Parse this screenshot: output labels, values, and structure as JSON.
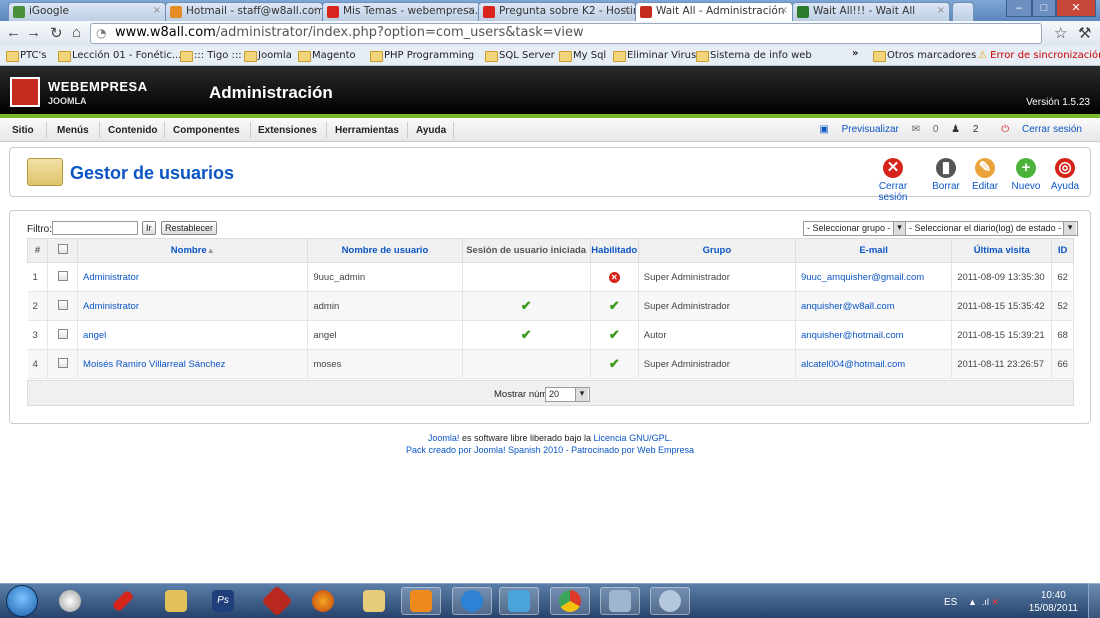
{
  "browser": {
    "tabs": [
      {
        "label": "iGoogle",
        "favicon_color": "#4a8f3a"
      },
      {
        "label": "Hotmail - staff@w8all.com",
        "favicon_color": "#e58b23"
      },
      {
        "label": "Mis Temas - webempresa.jo",
        "favicon_color": "#d8241c"
      },
      {
        "label": "Pregunta sobre K2 - Hosting",
        "favicon_color": "#d8241c"
      },
      {
        "label": "Wait All - Administración",
        "favicon_color": "#c62b1f"
      },
      {
        "label": "Wait All!!! - Wait All",
        "favicon_color": "#2a7a2a"
      }
    ],
    "url_host": "www.w8all.com",
    "url_path": "/administrator/index.php?option=com_users&task=view",
    "bookmarks": [
      "PTC's",
      "Lección 01 - Fonétic...",
      "::: Tigo :::",
      "Joomla",
      "Magento",
      "PHP Programming",
      "SQL Server",
      "My Sql",
      "Eliminar Virus",
      "Sistema de info web"
    ],
    "bookmarks_overflow": "»",
    "other_bookmarks": "Otros marcadores",
    "sync_error": "Error de sincronización"
  },
  "header": {
    "brand": "WEBEMPRESA",
    "brand_sub": "JOOMLA",
    "title": "Administración",
    "version": "Versión 1.5.23"
  },
  "menu": [
    "Sitio",
    "Menús",
    "Contenido",
    "Componentes",
    "Extensiones",
    "Herramientas",
    "Ayuda"
  ],
  "status": {
    "preview": "Previsualizar",
    "messages": "0",
    "users_online": "2",
    "logout": "Cerrar sesión"
  },
  "page": {
    "title": "Gestor de usuarios",
    "toolbar": [
      {
        "label": "Cerrar sesión",
        "color": "#d6241a",
        "glyph": "✕",
        "icon": "logout-icon"
      },
      {
        "label": "Borrar",
        "color": "#555555",
        "glyph": "▮",
        "icon": "trash-icon"
      },
      {
        "label": "Editar",
        "color": "#e8a33a",
        "glyph": "✎",
        "icon": "pencil-icon"
      },
      {
        "label": "Nuevo",
        "color": "#4bb33a",
        "glyph": "+",
        "icon": "plus-icon"
      },
      {
        "label": "Ayuda",
        "color": "#d6241a",
        "glyph": "◎",
        "icon": "help-icon"
      }
    ]
  },
  "filter": {
    "label": "Filtro:",
    "value": "",
    "go": "Ir",
    "reset": "Restablecer",
    "group_select": "- Seleccionar grupo -",
    "log_select": "- Seleccionar el diario(log) de estado -"
  },
  "table": {
    "headers": [
      "#",
      "",
      "Nombre",
      "Nombre de usuario",
      "Sesión de usuario iniciada",
      "Habilitado",
      "Grupo",
      "E-mail",
      "Última visita",
      "ID"
    ],
    "sort_arrow": "▲",
    "rows": [
      {
        "num": "1",
        "name": "Administrator",
        "username": "9uuc_admin",
        "logged_in": false,
        "enabled": false,
        "group": "Super Administrador",
        "email": "9uuc_amquisher@gmail.com",
        "last_visit": "2011-08-09 13:35:30",
        "id": "62"
      },
      {
        "num": "2",
        "name": "Administrator",
        "username": "admin",
        "logged_in": true,
        "enabled": true,
        "group": "Super Administrador",
        "email": "anquisher@w8all.com",
        "last_visit": "2011-08-15 15:35:42",
        "id": "52"
      },
      {
        "num": "3",
        "name": "angel",
        "username": "angel",
        "logged_in": true,
        "enabled": true,
        "group": "Autor",
        "email": "anquisher@hotmail.com",
        "last_visit": "2011-08-15 15:39:21",
        "id": "68"
      },
      {
        "num": "4",
        "name": "Moisés Ramiro Villarreal Sánchez",
        "username": "moses",
        "logged_in": false,
        "enabled": true,
        "group": "Super Administrador",
        "email": "alcatel004@hotmail.com",
        "last_visit": "2011-08-11 23:26:57",
        "id": "66"
      }
    ],
    "limit_label": "Mostrar núm.",
    "limit_value": "20"
  },
  "footer": {
    "joomla": "Joomla!",
    "text": "es software libre liberado bajo la",
    "license": "Licencia GNU/GPL.",
    "credit": "Pack creado por Joomla! Spanish 2010 - Patrocinado por Web Empresa"
  },
  "taskbar": {
    "lang": "ES",
    "time": "10:40",
    "date": "15/08/2011"
  }
}
